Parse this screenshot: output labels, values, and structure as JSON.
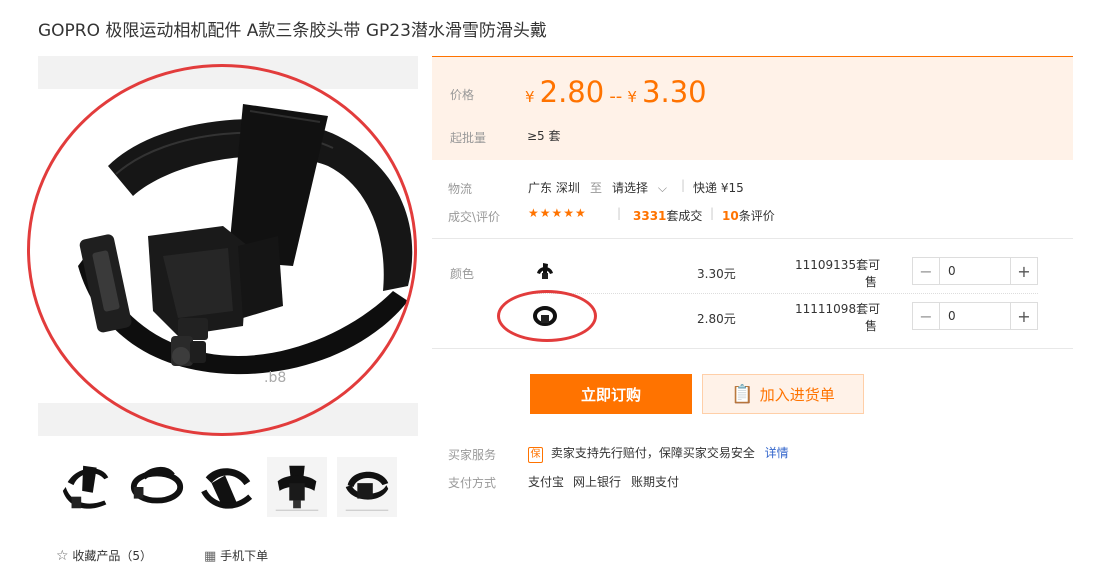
{
  "product": {
    "title": "GOPRO 极限运动相机配件 A款三条胶头带 GP23潜水滑雪防滑头戴"
  },
  "price": {
    "label": "价格",
    "currency": "¥",
    "low": "2.80",
    "separator": "--",
    "high": "3.30",
    "moq_label": "起批量",
    "moq_value": "≥5 套"
  },
  "logistics": {
    "label": "物流",
    "origin": "广东 深圳",
    "to": "至",
    "destination": "请选择",
    "shipping": "快递 ¥15"
  },
  "reviews": {
    "label": "成交\\评价",
    "stars": "★★★★★",
    "deals_count": "3331",
    "deals_unit": "套成交",
    "review_count": "10",
    "review_unit": "条评价"
  },
  "sku": {
    "label": "颜色",
    "rows": [
      {
        "price": "3.30元",
        "stock_num": "11109135",
        "stock_unit": "套可",
        "stock_unit2": "售",
        "qty": "0"
      },
      {
        "price": "2.80元",
        "stock_num": "11111098",
        "stock_unit": "套可",
        "stock_unit2": "售",
        "qty": "0"
      }
    ],
    "minus": "−",
    "plus": "+"
  },
  "actions": {
    "buy_now": "立即订购",
    "add_to_list": "加入进货单"
  },
  "service": {
    "label": "买家服务",
    "badge": "保",
    "text": "卖家支持先行赔付，保障买家交易安全",
    "details": "详情",
    "payment_label": "支付方式",
    "payment_methods": [
      "支付宝",
      "网上银行",
      "账期支付"
    ]
  },
  "footer": {
    "favorite": "收藏产品（5）",
    "mobile_order": "手机下单"
  },
  "colors": {
    "accent": "#ff7300",
    "annotation": "#e23c3c",
    "panel_bg": "#fff2e8"
  }
}
